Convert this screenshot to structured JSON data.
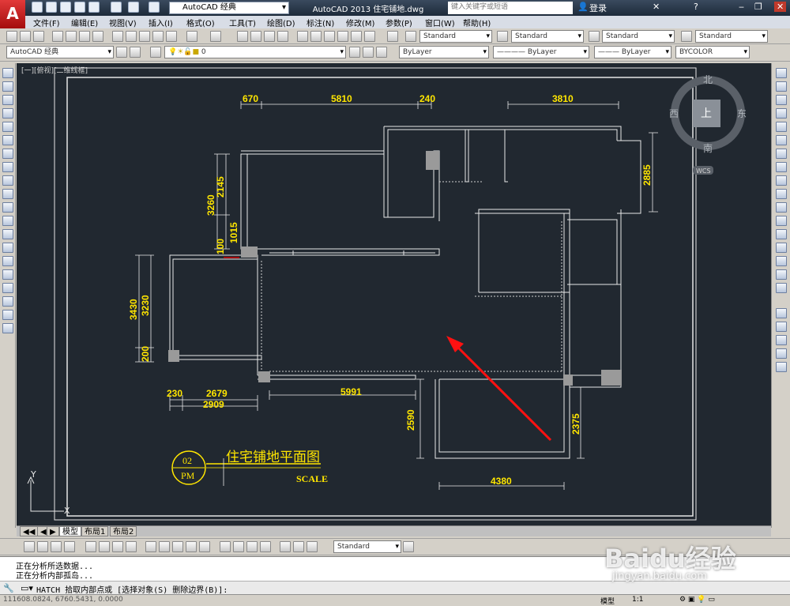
{
  "titlebar": {
    "workspace": "AutoCAD 经典",
    "app_title": "AutoCAD 2013   住宅铺地.dwg",
    "search_placeholder": "键入关键字或短语",
    "login": "登录"
  },
  "menu": [
    "文件(F)",
    "编辑(E)",
    "视图(V)",
    "插入(I)",
    "格式(O)",
    "工具(T)",
    "绘图(D)",
    "标注(N)",
    "修改(M)",
    "参数(P)",
    "窗口(W)",
    "帮助(H)"
  ],
  "styles_toolbar": {
    "text_style": "Standard",
    "dim_style": "Standard",
    "table_style": "Standard",
    "mleader_style": "Standard"
  },
  "layers_toolbar": {
    "workspace": "AutoCAD 经典",
    "layer": "0",
    "color": "ByLayer",
    "linetype": "ByLayer",
    "lineweight": "ByLayer",
    "plotstyle": "BYCOLOR"
  },
  "viewport_label": "[一][俯视][二维线框]",
  "viewcube": {
    "top": "上",
    "north": "北",
    "south": "南",
    "east": "东",
    "west": "西",
    "wcs": "WCS"
  },
  "drawing": {
    "dims": {
      "d670": "670",
      "d5810": "5810",
      "d240": "240",
      "d3810": "3810",
      "d2885": "2885",
      "d3260": "3260",
      "d2145": "2145",
      "d1015": "1015",
      "d100": "100",
      "d3430": "3430",
      "d3230": "3230",
      "d200": "200",
      "d230": "230",
      "d2679": "2679",
      "d2909": "2909",
      "d5991": "5991",
      "d2590": "2590",
      "d2375": "2375",
      "d4380": "4380"
    },
    "title": "住宅铺地平面图",
    "scale": "SCALE",
    "tag_top": "02",
    "tag_bottom": "PM",
    "ucs_y": "Y",
    "ucs_x": "X"
  },
  "tabs": [
    "模型",
    "布局1",
    "布局2"
  ],
  "dim_toolbar": {
    "style": "Standard"
  },
  "command": {
    "line1": "正在分析所选数据...",
    "line2": "正在分析内部孤岛...",
    "prompt": "HATCH 拾取内部点或 [选择对象(S) 删除边界(B)]:"
  },
  "status": {
    "coords": "111608.0824, 6760.5431, 0.0000",
    "model": "模型",
    "scale": "1:1"
  },
  "watermark": {
    "brand": "Baidu经验",
    "url": "jingyan.baidu.com"
  }
}
